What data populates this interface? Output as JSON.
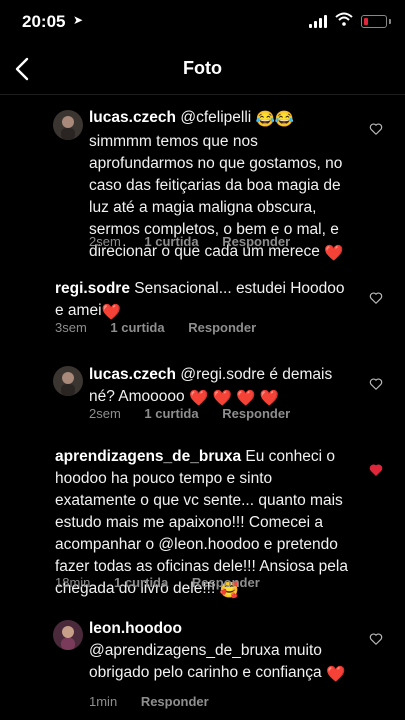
{
  "status": {
    "time": "20:05"
  },
  "nav": {
    "title": "Foto"
  },
  "colors": {
    "like_active": "#e0263a",
    "meta_text": "#8e8e8e",
    "background": "#000000"
  },
  "comments": [
    {
      "username": "lucas.czech",
      "mention": "@cfelipelli",
      "text": "simmmm temos que nos aprofundarmos no que gostamos, no caso das feitiçarias da boa magia de luz até a magia maligna obscura, sermos completos, o bem e o mal, e direcionar o que cada um merece",
      "emoji_lead": "😂😂",
      "emoji_tail": "❤️",
      "time": "2sem",
      "likes": "1 curtida",
      "reply": "Responder",
      "liked": false
    },
    {
      "username": "regi.sodre",
      "text": "Sensacional... estudei Hoodoo e amei",
      "emoji_tail": "❤️",
      "time": "3sem",
      "likes": "1 curtida",
      "reply": "Responder",
      "liked": false
    },
    {
      "username": "lucas.czech",
      "mention": "@regi.sodre",
      "text": "é demais né?  Amooooo",
      "emoji_tail": "❤️ ❤️ ❤️ ❤️",
      "time": "2sem",
      "likes": "1 curtida",
      "reply": "Responder",
      "liked": false
    },
    {
      "username": "aprendizagens_de_bruxa",
      "text": "Eu conheci o hoodoo ha pouco tempo e sinto exatamente o que vc sente... quanto mais estudo mais me apaixono!!! Comecei a acompanhar o @leon.hoodoo e pretendo fazer todas as oficinas dele!!! Ansiosa pela chegada do livro dele!!!",
      "emoji_tail": "🥰",
      "time": "18min",
      "likes": "1 curtida",
      "reply": "Responder",
      "liked": true
    },
    {
      "username": "leon.hoodoo",
      "mention": "@aprendizagens_de_bruxa",
      "text": "muito obrigado pelo carinho e confiança",
      "emoji_tail": "❤️",
      "time": "1min",
      "reply": "Responder",
      "liked": false
    }
  ]
}
